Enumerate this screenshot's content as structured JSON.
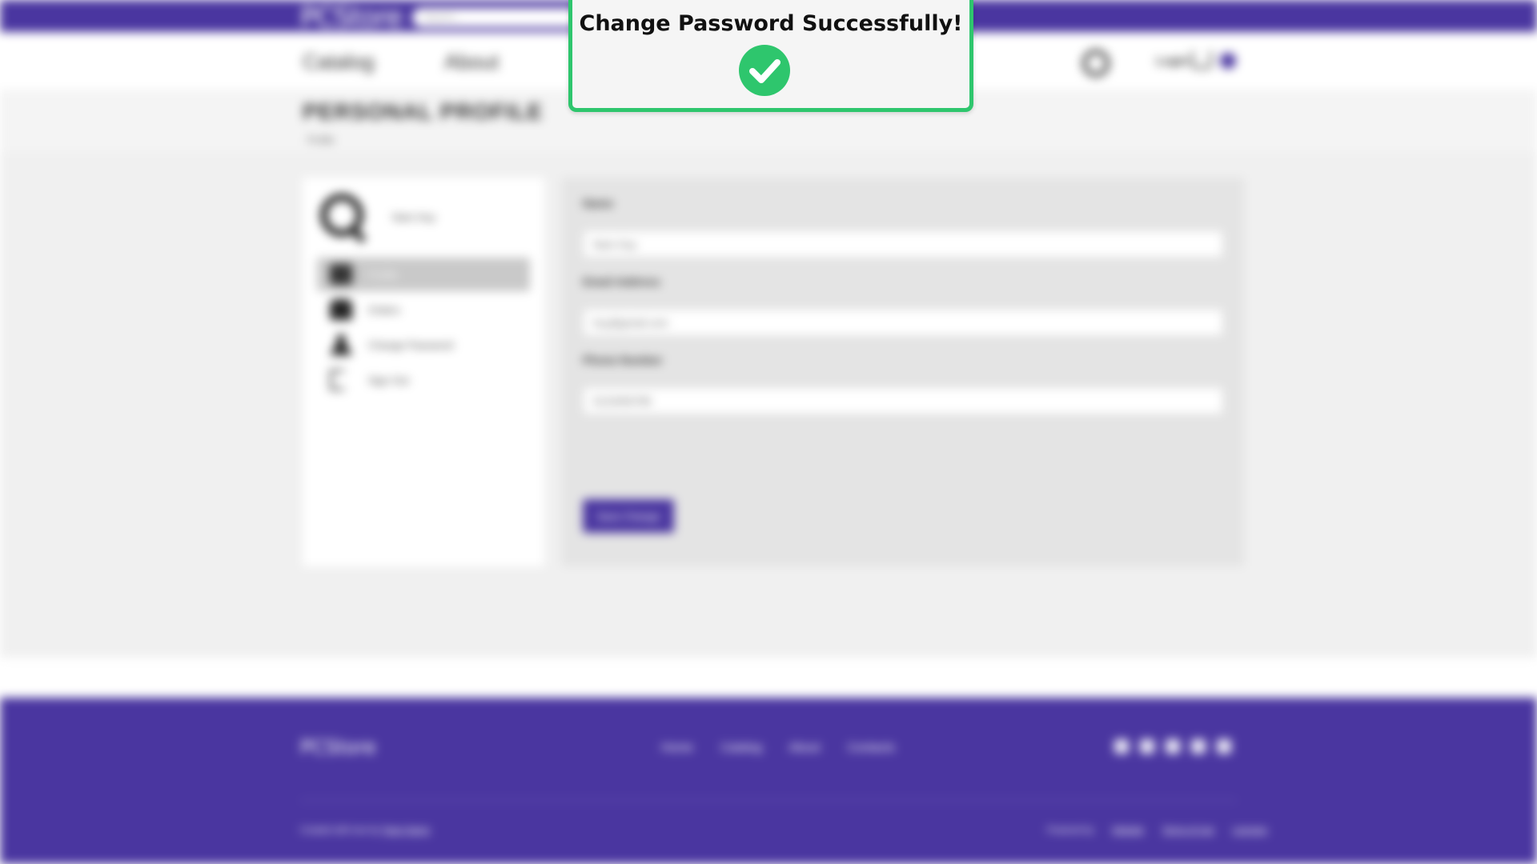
{
  "header": {
    "logo": "PCStore",
    "search_placeholder": "Search...",
    "nav": {
      "catalog": "Catalog",
      "about": "About"
    },
    "login": "Login"
  },
  "page": {
    "title": "PERSONAL PROFILE",
    "breadcrumb": "Profile"
  },
  "sidebar": {
    "user_name": "Nam Huy",
    "items": [
      {
        "label": "Profile",
        "icon": "profile-icon",
        "active": true
      },
      {
        "label": "Orders",
        "icon": "bag-icon",
        "active": false
      },
      {
        "label": "Change Password",
        "icon": "user-icon",
        "active": false
      },
      {
        "label": "Sign Out",
        "icon": "sign-out-icon",
        "active": false
      }
    ]
  },
  "form": {
    "name_label": "Name",
    "name_value": "Nam Huy",
    "email_label": "Email Address",
    "email_value": "huy@gmail.com",
    "phone_label": "Phone Number",
    "phone_value": "0123456789",
    "save_label": "Save Change"
  },
  "footer": {
    "logo": "PCStore",
    "nav": [
      "Home",
      "Catalog",
      "About",
      "Contacts"
    ],
    "copyright": "Created with love by",
    "copyright_link": "Team Name",
    "powered": "Powered by",
    "links": [
      "Website",
      "Terms of Use",
      "Licenses"
    ]
  },
  "toast": {
    "message": "Change Password Successfully!",
    "icon": "check-circle-icon"
  },
  "colors": {
    "brand": "#4a36a0",
    "success": "#2ec66d"
  }
}
